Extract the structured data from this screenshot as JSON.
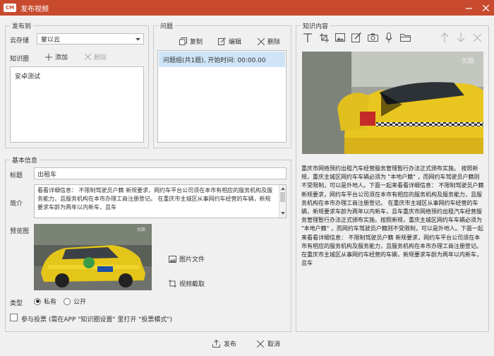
{
  "window": {
    "logo": "CM",
    "title": "发布视频",
    "controls": [
      "minimize-icon",
      "close-icon"
    ]
  },
  "publish_to": {
    "legend": "发布到",
    "cloud_label": "云存储",
    "cloud_value": "蒙以云",
    "circle_label": "知识圈",
    "add_label": "添加",
    "delete_label": "删除",
    "circles": [
      "安卓测试"
    ]
  },
  "questions": {
    "legend": "问题",
    "copy_label": "复制",
    "edit_label": "编辑",
    "delete_label": "删除",
    "items": [
      "问题组(共1题), 开始时间: 00:00.00"
    ]
  },
  "basic": {
    "legend": "基本信息",
    "title_label": "标题",
    "title_value": "出租车",
    "intro_label": "简介",
    "intro_value": "看看详细信息： 不限制驾驶员户籍        新规要求，网约车平台公司须在本市有相应的服务机构及服务能力，且服务机构在本市办理工商注册登记。        在重庆市主城区从事网约车经营的车辆，新规要求车龄为两年以内新车，且车",
    "preview_label": "预览图",
    "image_file_label": "图片文件",
    "video_capture_label": "视频截取",
    "type_label": "类型",
    "type_options": [
      "私有",
      "公开"
    ],
    "type_selected": "私有",
    "vote_label": "参与投票  (需在APP \"知识圈设置\" 里打开 \"投票模式\")"
  },
  "knowledge": {
    "legend": "知识内容",
    "toolbar": [
      "text-icon",
      "crop-icon",
      "image-icon",
      "pen-icon",
      "camera-icon",
      "microphone-icon",
      "folder-icon",
      "arrow-up-icon",
      "arrow-down-icon",
      "close-icon"
    ],
    "watermark": "优酷",
    "article": "重庆市网络预约出租汽车经营服务管理暂行办法正式颁布实施。 按照新规，重庆主城区网约车车辆必须为 \"本地户籍\" ，而网约车驾驶员户籍则不受限制，可以是外地人。下面一起来看看详细信息： 不限制驾驶员户籍   新规要求，网约车平台公司须在本市有相应的服务机构及服务能力，且服务机构在本市办理工商注册登记。   在重庆市主城区从事网约车经营的车辆，新规要求车龄为两年以内新车，且车重庆市网络预约出租汽车经营服务管理暂行办法正式颁布实施。按照新规，重庆主城区网约车车辆必须为 \"本地户籍\" ，而网约车驾驶员户籍则不受限制，可以是外地人。下面一起来看看详细信息： 不限制驾驶员户籍   新规要求，网约车平台公司须在本市有相应的服务机构及服务能力，且服务机构在本市办理工商注册登记。   在重庆市主城区从事网约车经营的车辆，新规要求车龄为两年以内新车，且车"
  },
  "footer": {
    "publish_label": "发布",
    "cancel_label": "取消"
  },
  "colors": {
    "titlebar": "#c84a2e",
    "selection": "#cfe4f7"
  }
}
